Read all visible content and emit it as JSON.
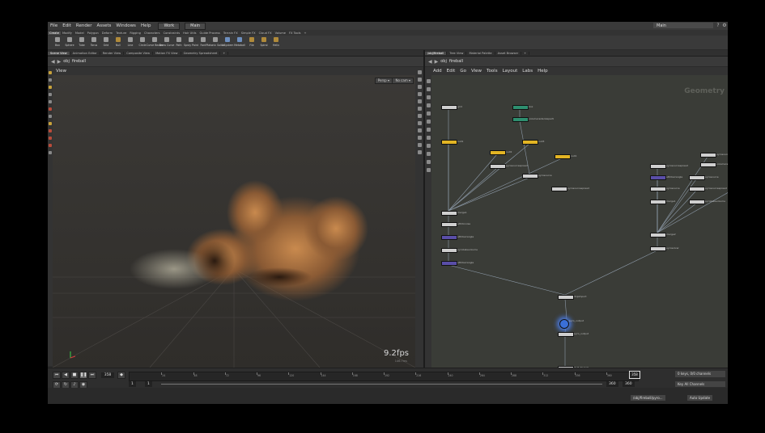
{
  "menubar": {
    "items": [
      "File",
      "Edit",
      "Render",
      "Assets",
      "Windows",
      "Help"
    ],
    "desktop": "Work",
    "context": "Main",
    "right_desktop": "Main"
  },
  "shelf": {
    "tabs": [
      "Create",
      "Modify",
      "Model",
      "Polygon",
      "Deform",
      "Texture",
      "Rigging",
      "Characters",
      "Constraints",
      "Hair Utils",
      "Guide Process",
      "Terrain FX",
      "Simple FX",
      "Cloud FX",
      "Volume",
      "FX Tools"
    ],
    "active_tab": 0,
    "tools": [
      {
        "label": "Box",
        "icon": "box-icon",
        "tint": "grey"
      },
      {
        "label": "Sphere",
        "icon": "sphere-icon",
        "tint": "grey"
      },
      {
        "label": "Tube",
        "icon": "tube-icon",
        "tint": "grey"
      },
      {
        "label": "Torus",
        "icon": "torus-icon",
        "tint": "grey"
      },
      {
        "label": "Grid",
        "icon": "grid-icon",
        "tint": "grey"
      },
      {
        "label": "Null",
        "icon": "null-icon",
        "tint": "alt"
      },
      {
        "label": "Line",
        "icon": "line-icon",
        "tint": "grey"
      },
      {
        "label": "Circle",
        "icon": "circle-icon",
        "tint": "grey"
      },
      {
        "label": "Curve Bezier",
        "icon": "curve-icon",
        "tint": "grey"
      },
      {
        "label": "Draw Curve",
        "icon": "draw-curve-icon",
        "tint": "grey"
      },
      {
        "label": "Path",
        "icon": "path-icon",
        "tint": "grey"
      },
      {
        "label": "Spray Paint",
        "icon": "spray-icon",
        "tint": "grey"
      },
      {
        "label": "Font",
        "icon": "font-icon",
        "tint": "grey"
      },
      {
        "label": "Platonic Solids",
        "icon": "platonic-icon",
        "tint": "grey"
      },
      {
        "label": "L-System",
        "icon": "lsystem-icon",
        "tint": "blue"
      },
      {
        "label": "Metaball",
        "icon": "metaball-icon",
        "tint": "blue"
      },
      {
        "label": "File",
        "icon": "file-icon",
        "tint": "alt"
      },
      {
        "label": "Spiral",
        "icon": "spiral-icon",
        "tint": "alt"
      },
      {
        "label": "Helix",
        "icon": "helix-icon",
        "tint": "alt"
      }
    ]
  },
  "left_pane": {
    "tabs": [
      "Scene View",
      "Animation Editor",
      "Render View",
      "Composite View",
      "Motion FX View",
      "Geometry Spreadsheet"
    ],
    "path_root": "obj",
    "path_node": "fireball",
    "viewport_title": "View",
    "camera_persp": "Persp",
    "camera_cam": "No cam",
    "fps": "9.2fps",
    "fps_sub": "146.7ms"
  },
  "right_pane": {
    "tabs": [
      "/obj/fireball",
      "Tree View",
      "Material Palette",
      "Asset Browser"
    ],
    "path_root": "obj",
    "path_node": "fireball",
    "menu": [
      "Add",
      "Edit",
      "Go",
      "View",
      "Tools",
      "Layout",
      "Labs",
      "Help"
    ],
    "context_label": "Geometry",
    "node_labels": [
      "grid",
      "box",
      "volumerasterizeparti",
      "null1",
      "null2",
      "null3",
      "pyrosourcespread",
      "pyrosource",
      "merge1",
      "attribnoise",
      "attribwrangle",
      "pyrobakevolume",
      "merge2",
      "pyrosolver",
      "dopimport",
      "pyro_output",
      "OUT_fireball",
      "pyrosourcepack",
      "volumerasterize"
    ],
    "node_colors": {
      "default": "#cfcfcf",
      "yellow": "#e3b524",
      "purple": "#5a4ea8",
      "green": "#2e8f6f",
      "selected": "#3a6fd8"
    }
  },
  "timeline": {
    "current_frame": "358",
    "ticks": [
      "24",
      "48",
      "72",
      "96",
      "120",
      "144",
      "168",
      "192",
      "216",
      "240",
      "264",
      "288",
      "312",
      "336",
      "360"
    ],
    "end_frame": "358",
    "start": "1",
    "start2": "1",
    "end": "360",
    "end2": "360",
    "keys_label": "0 keys, 0/0 channels",
    "key_all": "Key All Channels"
  },
  "statusbar": {
    "path": "/obj/fireball/pyro...",
    "auto_update": "Auto Update"
  }
}
